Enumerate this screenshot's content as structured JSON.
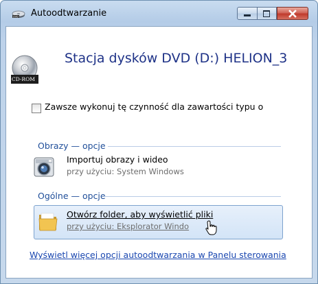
{
  "window": {
    "title": "Autoodtwarzanie",
    "controls": {
      "minimize": "minimize-icon",
      "maximize": "maximize-icon",
      "close": "close-icon"
    }
  },
  "drive": {
    "title": "Stacja dysków DVD (D:) HELION_3",
    "icon": "cd-rom-icon",
    "icon_badge": "CD-ROM"
  },
  "always_checkbox": {
    "label": "Zawsze wykonuj tę czynność dla zawartości typu o",
    "checked": false
  },
  "sections": [
    {
      "heading": "Obrazy — opcje",
      "items": [
        {
          "title": "Importuj obrazy i wideo",
          "subtitle": "przy użyciu: System Windows",
          "icon": "camera-icon"
        }
      ]
    },
    {
      "heading": "Ogólne — opcje",
      "items": [
        {
          "title": "Otwórz folder, aby wyświetlić pliki",
          "subtitle": "przy użyciu: Eksplorator Windo",
          "icon": "folder-icon",
          "hovered": true
        }
      ]
    }
  ],
  "more_link": "Wyświetl więcej opcji autoodtwarzania w Panelu sterowania",
  "colors": {
    "accent": "#1f4e99",
    "link": "#1a47b0",
    "title_blue": "#1e3287",
    "close_red": "#c03a2c"
  }
}
